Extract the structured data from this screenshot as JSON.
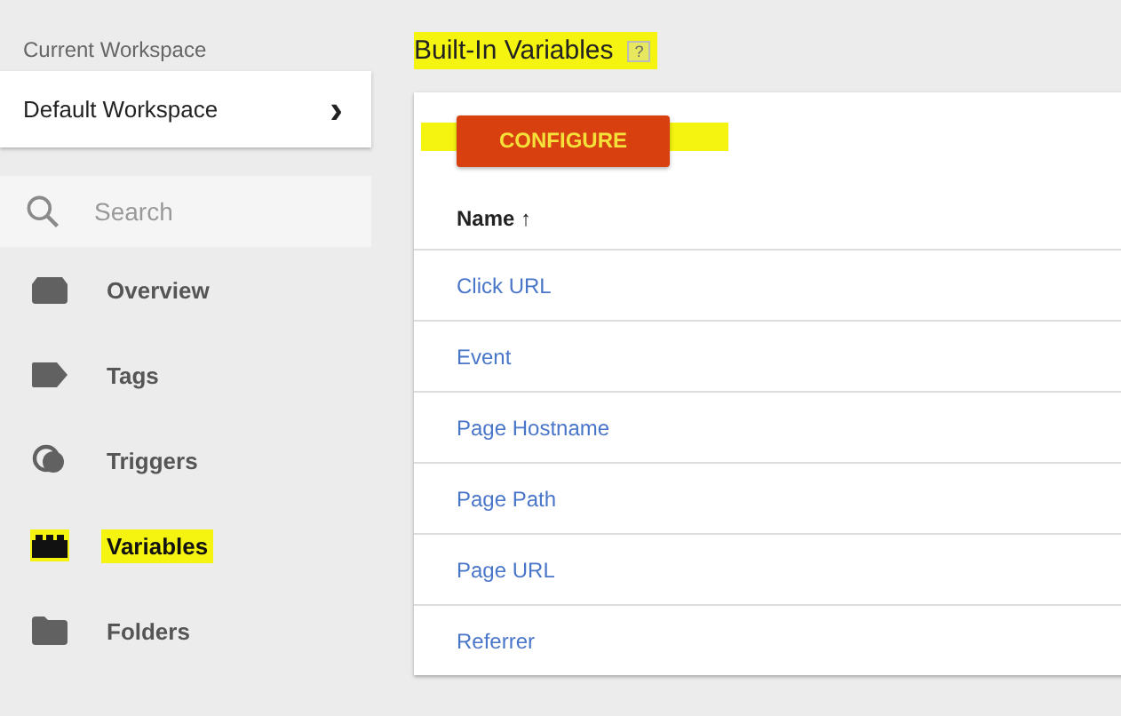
{
  "sidebar": {
    "workspace_label": "Current Workspace",
    "workspace": {
      "name": "Default Workspace",
      "chevron": "›"
    },
    "search": {
      "placeholder": "Search"
    },
    "items": [
      {
        "label": "Overview",
        "kind": "overview",
        "highlighted": false
      },
      {
        "label": "Tags",
        "kind": "tags",
        "highlighted": false
      },
      {
        "label": "Triggers",
        "kind": "triggers",
        "highlighted": false
      },
      {
        "label": "Variables",
        "kind": "variables",
        "highlighted": true
      },
      {
        "label": "Folders",
        "kind": "folders",
        "highlighted": false
      }
    ]
  },
  "main": {
    "title": "Built-In Variables",
    "title_highlighted": true,
    "help": "?",
    "configure": {
      "label": "CONFIGURE",
      "highlighted": true
    },
    "table": {
      "columns": [
        {
          "label": "Name",
          "sort": "↑"
        }
      ],
      "rows": [
        "Click URL",
        "Event",
        "Page Hostname",
        "Page Path",
        "Page URL",
        "Referrer"
      ]
    }
  }
}
